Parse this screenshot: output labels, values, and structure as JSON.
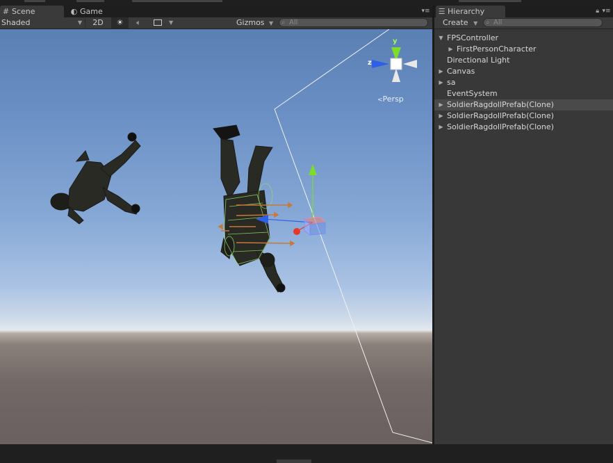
{
  "scene_panel": {
    "tabs": [
      {
        "label": "Scene",
        "icon": "grid-icon",
        "active": true
      },
      {
        "label": "Game",
        "icon": "pacman-icon",
        "active": false
      }
    ],
    "toolbar": {
      "shading_mode": "Shaded",
      "mode_2d_label": "2D",
      "lighting_icon": "sun-icon",
      "audio_icon": "speaker-icon",
      "effects_icon": "image-icon",
      "gizmos_label": "Gizmos",
      "search_placeholder": "All"
    },
    "gizmo": {
      "y_label": "y",
      "z_label": "z",
      "projection_label": "Persp"
    }
  },
  "hierarchy_panel": {
    "tab_label": "Hierarchy",
    "tab_icon": "list-icon",
    "create_label": "Create",
    "search_placeholder": "All",
    "items": [
      {
        "label": "FPSController",
        "depth": 0,
        "expanded": true,
        "has_children": true,
        "selected": false
      },
      {
        "label": "FirstPersonCharacter",
        "depth": 1,
        "expanded": false,
        "has_children": true,
        "selected": false
      },
      {
        "label": "Directional Light",
        "depth": 0,
        "expanded": false,
        "has_children": false,
        "selected": false
      },
      {
        "label": "Canvas",
        "depth": 0,
        "expanded": false,
        "has_children": true,
        "selected": false
      },
      {
        "label": "sa",
        "depth": 0,
        "expanded": false,
        "has_children": true,
        "selected": false
      },
      {
        "label": "EventSystem",
        "depth": 0,
        "expanded": false,
        "has_children": false,
        "selected": false
      },
      {
        "label": "SoldierRagdollPrefab(Clone)",
        "depth": 0,
        "expanded": false,
        "has_children": true,
        "selected": true
      },
      {
        "label": "SoldierRagdollPrefab(Clone)",
        "depth": 0,
        "expanded": false,
        "has_children": true,
        "selected": false
      },
      {
        "label": "SoldierRagdollPrefab(Clone)",
        "depth": 0,
        "expanded": false,
        "has_children": true,
        "selected": false
      }
    ]
  },
  "colors": {
    "editor_bg": "#383838",
    "selection": "#4a4a4a",
    "axis_x": "#e8362a",
    "axis_y": "#7ddc2a",
    "axis_z": "#2f5fe6"
  }
}
